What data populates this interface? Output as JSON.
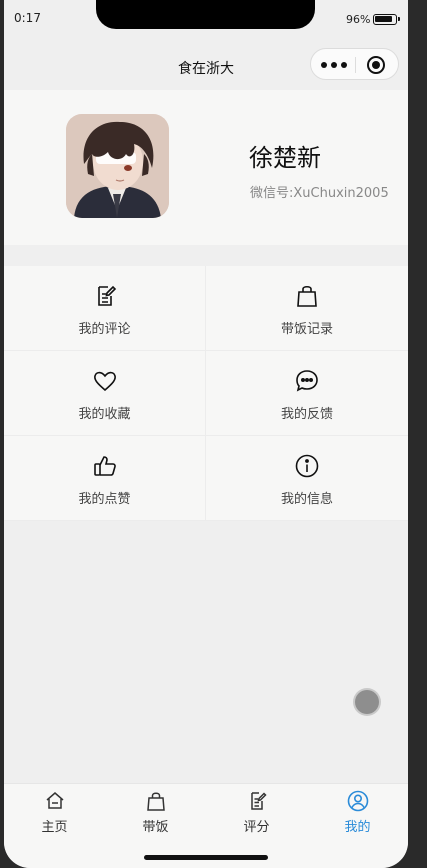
{
  "status_bar": {
    "time": "0:17",
    "battery": "96%"
  },
  "nav": {
    "title": "食在浙大"
  },
  "profile": {
    "name": "徐楚新",
    "wechat": "微信号:XuChuxin2005"
  },
  "menu": {
    "items": [
      {
        "label": "我的评论",
        "icon": "edit-note-icon"
      },
      {
        "label": "带饭记录",
        "icon": "bag-icon"
      },
      {
        "label": "我的收藏",
        "icon": "heart-icon"
      },
      {
        "label": "我的反馈",
        "icon": "chat-icon"
      },
      {
        "label": "我的点赞",
        "icon": "thumbs-up-icon"
      },
      {
        "label": "我的信息",
        "icon": "info-icon"
      }
    ]
  },
  "tabs": [
    {
      "label": "主页",
      "icon": "home-icon",
      "active": false
    },
    {
      "label": "带饭",
      "icon": "bag-icon",
      "active": false
    },
    {
      "label": "评分",
      "icon": "edit-note-icon",
      "active": false
    },
    {
      "label": "我的",
      "icon": "user-icon",
      "active": true
    }
  ],
  "colors": {
    "accent": "#2a8bd8",
    "background": "#efefef",
    "card": "#f7f7f6"
  }
}
